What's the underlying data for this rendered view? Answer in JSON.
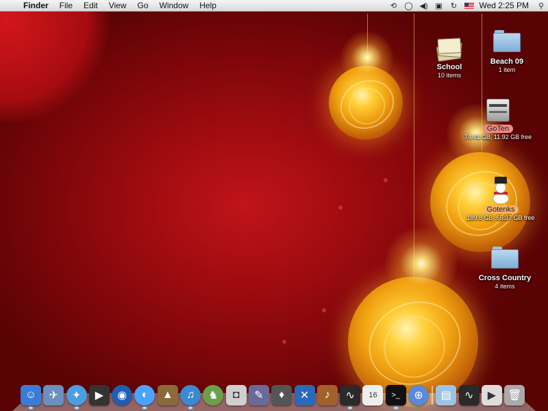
{
  "menubar": {
    "apple_glyph": "",
    "app_name": "Finder",
    "menus": [
      "File",
      "Edit",
      "View",
      "Go",
      "Window",
      "Help"
    ],
    "status_icons": [
      "time-machine-icon",
      "chat-icon",
      "volume-icon",
      "spaces-icon",
      "sync-icon",
      "input-flag-icon",
      "spotlight-icon"
    ],
    "clock": "Wed 2:25 PM"
  },
  "desktop": {
    "icons": [
      {
        "name": "School",
        "info": "10 items",
        "icon": "stack-icon"
      },
      {
        "name": "Beach 09",
        "info": "1 item",
        "icon": "folder-icon"
      },
      {
        "name": "GoTen",
        "info": "74.41 GB, 11.92 GB free",
        "icon": "hard-drive-icon",
        "label_color": "#f08a8a"
      },
      {
        "name": "Gotenks",
        "info": "189.8 GB, 65.37 GB free",
        "icon": "snowman-icon",
        "label_color": "#f5b26a"
      },
      {
        "name": "Cross Country",
        "info": "4 items",
        "icon": "folder-icon"
      }
    ]
  },
  "dock": {
    "apps": [
      {
        "icon": "finder-icon",
        "color": "#3a7bd5",
        "glyph": "☺",
        "running": true
      },
      {
        "icon": "mail-icon",
        "color": "#6a8fc0",
        "glyph": "✈",
        "running": false
      },
      {
        "icon": "safari-icon",
        "color": "#4a9ee0",
        "glyph": "✦",
        "running": true
      },
      {
        "icon": "imovie-icon",
        "color": "#333333",
        "glyph": "▶",
        "running": false
      },
      {
        "icon": "dvd-player-icon",
        "color": "#1e5fb0",
        "glyph": "◉",
        "running": false
      },
      {
        "icon": "ichat-icon",
        "color": "#4aa3ff",
        "glyph": "◐",
        "running": true
      },
      {
        "icon": "iphoto-icon",
        "color": "#8a6a3a",
        "glyph": "▲",
        "running": false
      },
      {
        "icon": "itunes-icon",
        "color": "#3a8ad0",
        "glyph": "♫",
        "running": true
      },
      {
        "icon": "chess-icon",
        "color": "#6aa04a",
        "glyph": "♞",
        "running": false
      },
      {
        "icon": "image-capture-icon",
        "color": "#cfcfcf",
        "glyph": "◘",
        "running": false
      },
      {
        "icon": "script-editor-icon",
        "color": "#6a6a9a",
        "glyph": "✎",
        "running": false
      },
      {
        "icon": "podcast-capture-icon",
        "color": "#555555",
        "glyph": "♦",
        "running": false
      },
      {
        "icon": "xcode-icon",
        "color": "#2a6ab8",
        "glyph": "✕",
        "running": false
      },
      {
        "icon": "garageband-icon",
        "color": "#a0622a",
        "glyph": "♪",
        "running": false
      },
      {
        "icon": "activity-monitor-icon",
        "color": "#2a2a2a",
        "glyph": "∿",
        "running": true
      },
      {
        "icon": "ical-icon",
        "color": "#eeeeee",
        "glyph": "16",
        "running": false
      },
      {
        "icon": "terminal-icon",
        "color": "#111111",
        "glyph": ">_",
        "running": true
      },
      {
        "icon": "network-utility-icon",
        "color": "#5a8ad8",
        "glyph": "⊕",
        "running": false
      }
    ],
    "others": [
      {
        "icon": "applications-stack-icon",
        "color": "#9cc3e2",
        "glyph": "▤",
        "running": false
      },
      {
        "icon": "activity-stack-icon",
        "color": "#2a2a2a",
        "glyph": "∿",
        "running": false
      },
      {
        "icon": "quicktime-icon",
        "color": "#dddddd",
        "glyph": "▶",
        "running": false
      },
      {
        "icon": "trash-icon",
        "color": "#aaaaaa",
        "glyph": "🗑",
        "running": false
      }
    ]
  }
}
